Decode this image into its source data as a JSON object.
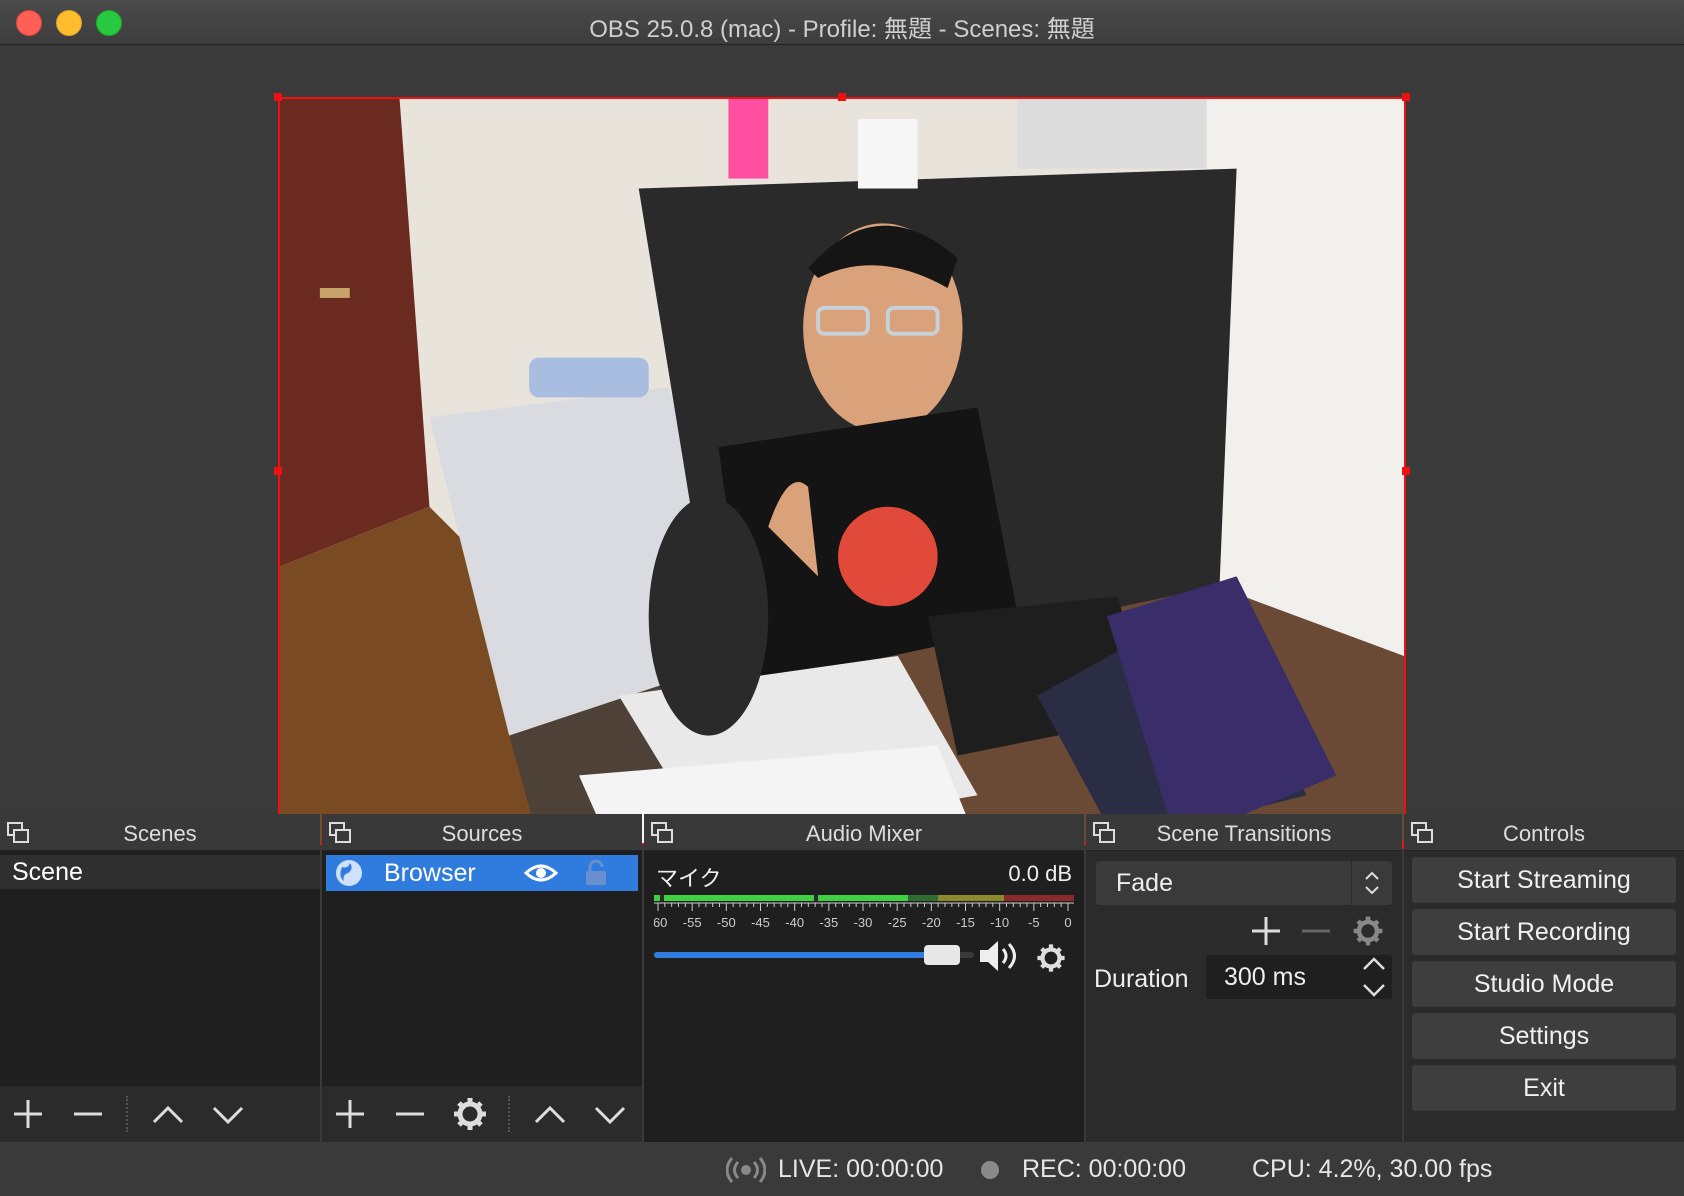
{
  "window": {
    "title": "OBS 25.0.8 (mac) - Profile: 無題 - Scenes: 無題"
  },
  "scenes": {
    "header": "Scenes",
    "items": [
      {
        "label": "Scene"
      }
    ]
  },
  "sources": {
    "header": "Sources",
    "items": [
      {
        "label": "Browser"
      }
    ]
  },
  "audio_mixer": {
    "header": "Audio Mixer",
    "channel": {
      "name": "マイク",
      "level": "0.0 dB",
      "volume_fraction": 0.95,
      "scale": [
        "-60",
        "-55",
        "-50",
        "-45",
        "-40",
        "-35",
        "-30",
        "-25",
        "-20",
        "-15",
        "-10",
        "-5",
        "0"
      ]
    }
  },
  "scene_transitions": {
    "header": "Scene Transitions",
    "selected": "Fade",
    "duration_label": "Duration",
    "duration_value": "300 ms"
  },
  "controls": {
    "header": "Controls",
    "buttons": [
      {
        "label": "Start Streaming"
      },
      {
        "label": "Start Recording"
      },
      {
        "label": "Studio Mode"
      },
      {
        "label": "Settings"
      },
      {
        "label": "Exit"
      }
    ]
  },
  "status": {
    "live": "LIVE: 00:00:00",
    "rec": "REC: 00:00:00",
    "cpu": "CPU: 4.2%, 30.00 fps"
  },
  "colors": {
    "accent": "#2f7bde",
    "selection_border": "#ee1111",
    "meter_green": "#3fd13f",
    "meter_yellow": "#c9c93a",
    "meter_red": "#d03a3a"
  }
}
